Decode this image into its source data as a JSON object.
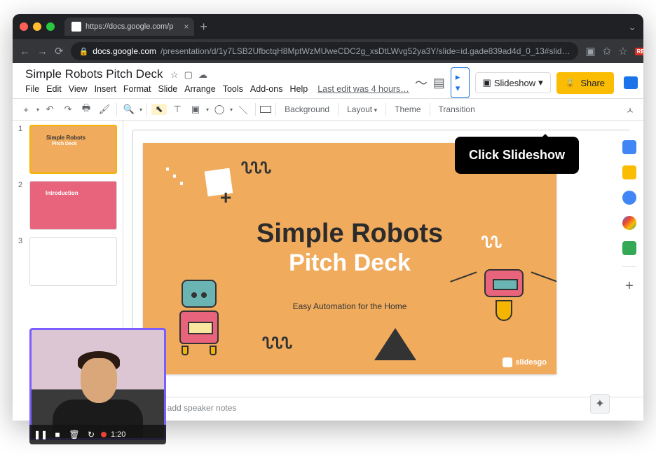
{
  "browser": {
    "tab_title": "https://docs.google.com/p",
    "url_host": "docs.google.com",
    "url_path": "/presentation/d/1y7LSB2UfbctqH8MptWzMUweCDC2g_xsDtLWvg52ya3Y/slide=id.gade839ad4d_0_13#slid…"
  },
  "header": {
    "doc_title": "Simple Robots Pitch Deck",
    "menus": [
      "File",
      "Edit",
      "View",
      "Insert",
      "Format",
      "Slide",
      "Arrange",
      "Tools",
      "Add-ons",
      "Help"
    ],
    "last_edit": "Last edit was 4 hours…",
    "slideshow_label": "Slideshow",
    "share_label": "Share"
  },
  "toolbar": {
    "background": "Background",
    "layout": "Layout",
    "theme": "Theme",
    "transition": "Transition"
  },
  "filmstrip": {
    "slides": [
      {
        "num": "1",
        "title": "Simple Robots",
        "subtitle": "Pitch Deck"
      },
      {
        "num": "2",
        "title": "Introduction",
        "subtitle": ""
      },
      {
        "num": "3",
        "title": "",
        "subtitle": ""
      }
    ]
  },
  "slide": {
    "title_line1": "Simple Robots",
    "title_line2": "Pitch Deck",
    "tagline": "Easy Automation for the Home",
    "attribution": "slidesgo"
  },
  "speaker_notes_placeholder": "Click to add speaker notes",
  "loom": {
    "time": "1:20"
  },
  "callout_text": "Click Slideshow"
}
